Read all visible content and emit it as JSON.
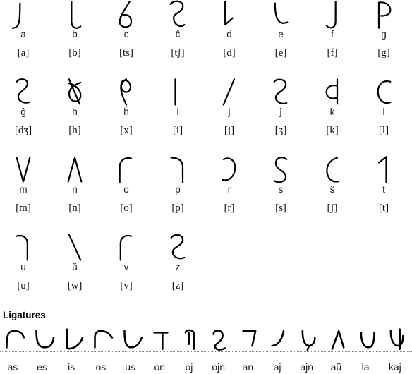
{
  "alphabet": {
    "letters": [
      {
        "glyph": "glyph-a",
        "latin": "a",
        "ipa": "[a]"
      },
      {
        "glyph": "glyph-b",
        "latin": "b",
        "ipa": "[b]"
      },
      {
        "glyph": "glyph-c",
        "latin": "c",
        "ipa": "[ts]"
      },
      {
        "glyph": "glyph-cx",
        "latin": "ĉ",
        "ipa": "[tʃ]"
      },
      {
        "glyph": "glyph-d",
        "latin": "d",
        "ipa": "[d]"
      },
      {
        "glyph": "glyph-e",
        "latin": "e",
        "ipa": "[e]"
      },
      {
        "glyph": "glyph-f",
        "latin": "f",
        "ipa": "[f]"
      },
      {
        "glyph": "glyph-g",
        "latin": "g",
        "ipa": "[g]"
      },
      {
        "glyph": "glyph-gx",
        "latin": "ĝ",
        "ipa": "[dʒ]"
      },
      {
        "glyph": "glyph-h",
        "latin": "h",
        "ipa": "[h]"
      },
      {
        "glyph": "glyph-hx",
        "latin": "ĥ",
        "ipa": "[x]"
      },
      {
        "glyph": "glyph-i",
        "latin": "i",
        "ipa": "[i]"
      },
      {
        "glyph": "glyph-j",
        "latin": "j",
        "ipa": "[j]"
      },
      {
        "glyph": "glyph-jx",
        "latin": "ĵ",
        "ipa": "[ʒ]"
      },
      {
        "glyph": "glyph-k",
        "latin": "k",
        "ipa": "[k]"
      },
      {
        "glyph": "glyph-l",
        "latin": "l",
        "ipa": "[l]"
      },
      {
        "glyph": "glyph-m",
        "latin": "m",
        "ipa": "[m]"
      },
      {
        "glyph": "glyph-n",
        "latin": "n",
        "ipa": "[n]"
      },
      {
        "glyph": "glyph-o",
        "latin": "o",
        "ipa": "[o]"
      },
      {
        "glyph": "glyph-p",
        "latin": "p",
        "ipa": "[p]"
      },
      {
        "glyph": "glyph-r",
        "latin": "r",
        "ipa": "[r]"
      },
      {
        "glyph": "glyph-s",
        "latin": "s",
        "ipa": "[s]"
      },
      {
        "glyph": "glyph-sx",
        "latin": "ŝ",
        "ipa": "[ʃ]"
      },
      {
        "glyph": "glyph-t",
        "latin": "t",
        "ipa": "[t]"
      },
      {
        "glyph": "glyph-u",
        "latin": "u",
        "ipa": "[u]"
      },
      {
        "glyph": "glyph-ux",
        "latin": "ŭ",
        "ipa": "[w]"
      },
      {
        "glyph": "glyph-v",
        "latin": "v",
        "ipa": "[v]"
      },
      {
        "glyph": "glyph-z",
        "latin": "z",
        "ipa": "[z]"
      }
    ]
  },
  "ligatures": {
    "heading": "Ligatures",
    "items": [
      {
        "glyph": "lig-as",
        "label": "as"
      },
      {
        "glyph": "lig-es",
        "label": "es"
      },
      {
        "glyph": "lig-is",
        "label": "is"
      },
      {
        "glyph": "lig-os",
        "label": "os"
      },
      {
        "glyph": "lig-us",
        "label": "us"
      },
      {
        "glyph": "lig-on",
        "label": "on"
      },
      {
        "glyph": "lig-oj",
        "label": "oj"
      },
      {
        "glyph": "lig-ojn",
        "label": "ojn"
      },
      {
        "glyph": "lig-an",
        "label": "an"
      },
      {
        "glyph": "lig-aj",
        "label": "aj"
      },
      {
        "glyph": "lig-ajn",
        "label": "ajn"
      },
      {
        "glyph": "lig-aux",
        "label": "aŭ"
      },
      {
        "glyph": "lig-la",
        "label": "la"
      },
      {
        "glyph": "lig-kaj",
        "label": "kaj"
      }
    ]
  },
  "colors": {
    "ink": "#000000",
    "text": "#1a1a1a",
    "guide_line": "#888888",
    "background": "#ffffff"
  }
}
